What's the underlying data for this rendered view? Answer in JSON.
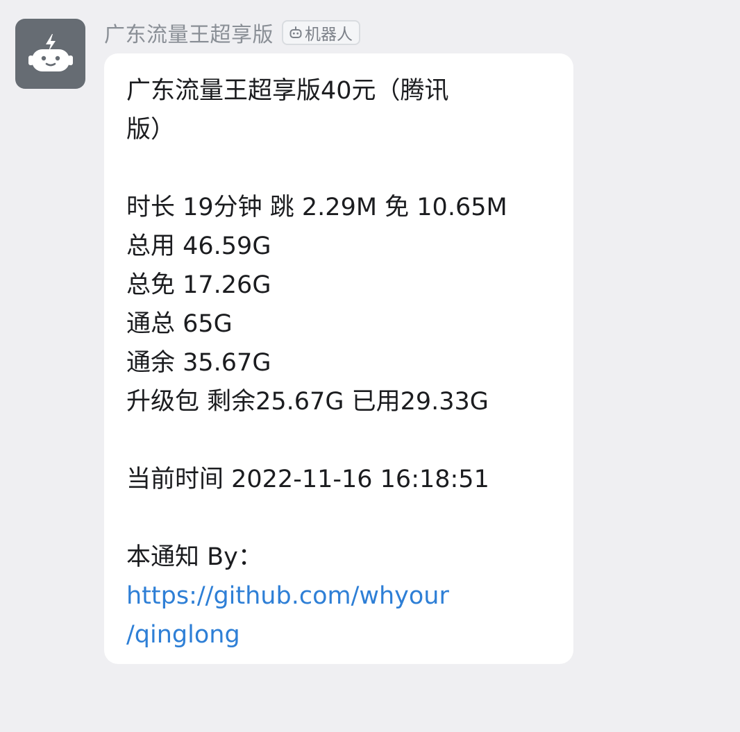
{
  "sender": {
    "name": "广东流量王超享版",
    "badge_icon": "robot-icon",
    "badge_label": "机器人",
    "avatar_icon": "robot-lightning-icon"
  },
  "message": {
    "title_line1": "广东流量王超享版40元（腾讯",
    "title_line2": "版）",
    "stats": [
      "时长 19分钟 跳 2.29M 免 10.65M",
      "总用 46.59G",
      "总免 17.26G",
      "通总 65G",
      "通余 35.67G",
      "升级包 剩余25.67G 已用29.33G"
    ],
    "current_time": "当前时间 2022-11-16 16:18:51",
    "notice_by": "本通知 By：",
    "link_line1": "https://github.com/whyour",
    "link_line2": "/qinglong"
  },
  "colors": {
    "background": "#efeff2",
    "avatar_bg": "#666c73",
    "bubble_bg": "#ffffff",
    "link": "#2e7fd6",
    "text": "#1b1c1f",
    "sender_text": "#8a8f96"
  }
}
